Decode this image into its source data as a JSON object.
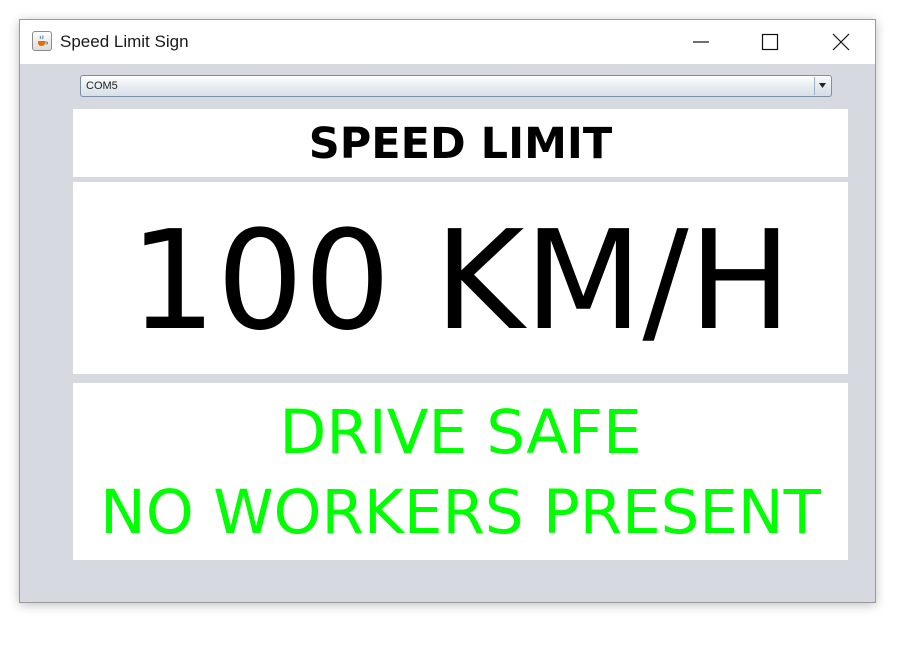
{
  "window": {
    "title": "Speed Limit Sign",
    "icon": "java-cup-icon",
    "controls": [
      "minimize-icon",
      "maximize-icon",
      "close-icon"
    ]
  },
  "port_select": {
    "value": "COM5",
    "icon": "dropdown-arrow-icon"
  },
  "sign": {
    "header": "SPEED LIMIT",
    "speed": "100 KM/H",
    "message_line1": "DRIVE SAFE",
    "message_line2": "NO WORKERS PRESENT"
  },
  "colors": {
    "window_background": "#d6d9df",
    "panel_background": "#ffffff",
    "header_text": "#000000",
    "speed_text": "#000000",
    "message_text": "#00ff00"
  }
}
